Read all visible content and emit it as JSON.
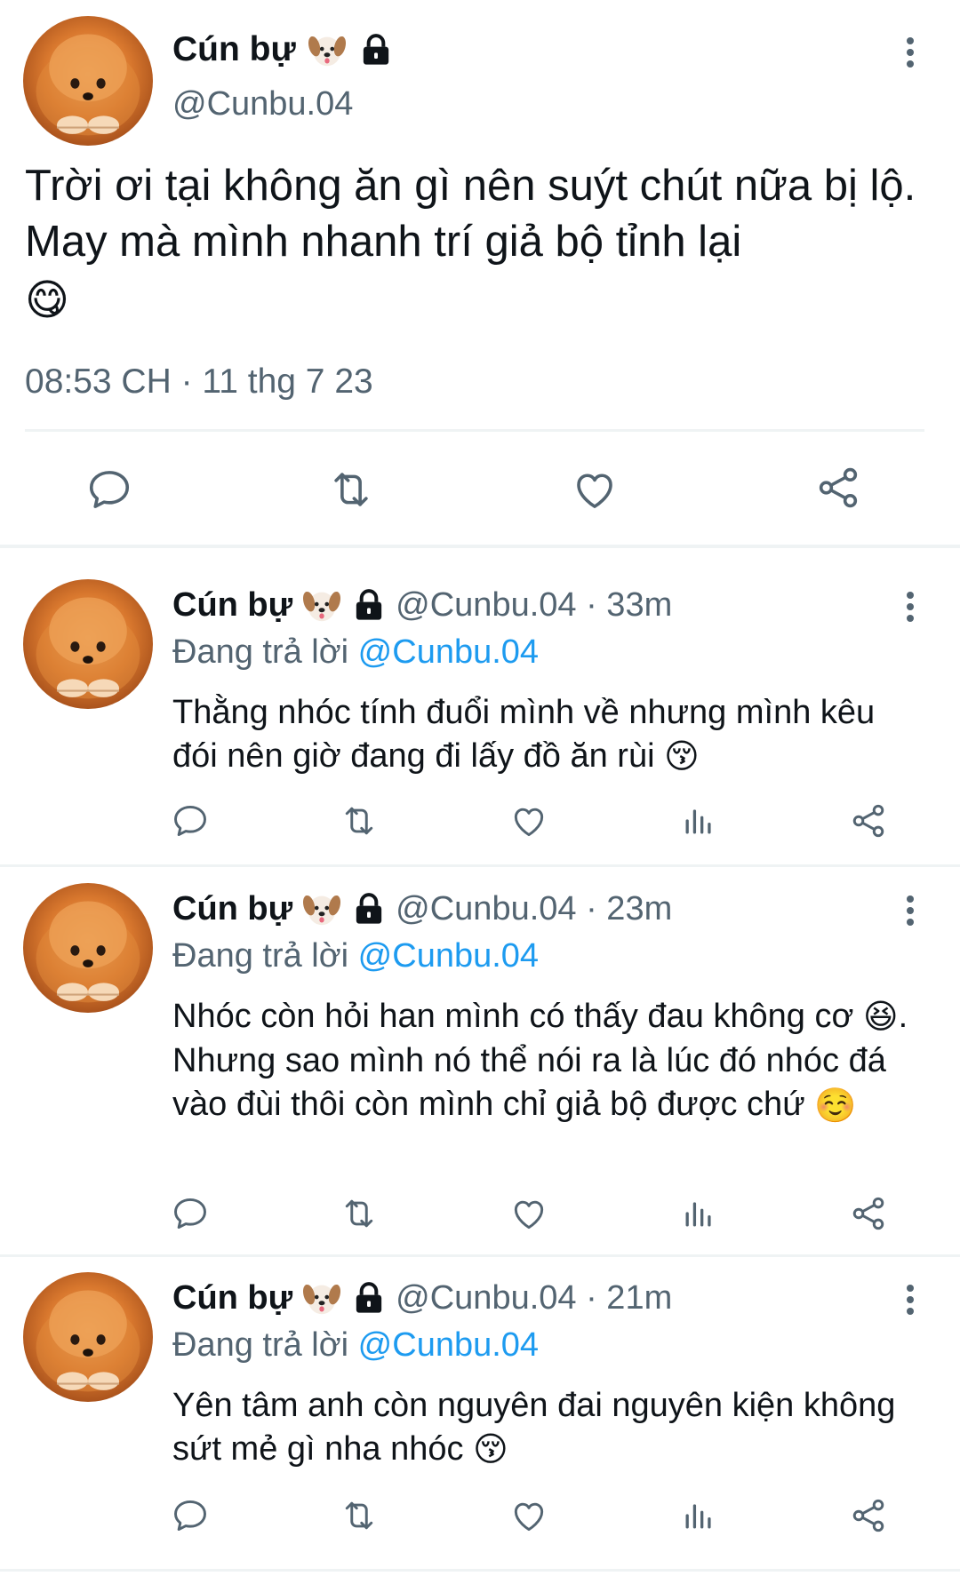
{
  "main_tweet": {
    "author_name": "Cún bự",
    "author_handle": "@Cunbu.04",
    "text": "Trời ơi tại không ăn gì nên suýt chút nữa bị lộ. May mà mình nhanh trí giả bộ tỉnh lại",
    "emoji": "😋",
    "timestamp": "08:53 CH · 11 thg 7 23",
    "actions": [
      "reply-icon",
      "retweet-icon",
      "like-icon",
      "share-icon"
    ]
  },
  "replies": [
    {
      "author_name": "Cún bự",
      "handle_time": "@Cunbu.04 · 33m",
      "replying_label": "Đang trả lời",
      "replying_to": "@Cunbu.04",
      "text": "Thằng nhóc tính đuổi mình về nhưng mình kêu đói nên giờ đang đi lấy đồ ăn rùi",
      "emoji": "😚"
    },
    {
      "author_name": "Cún bự",
      "handle_time": "@Cunbu.04 · 23m",
      "replying_label": "Đang trả lời",
      "replying_to": "@Cunbu.04",
      "text_part1": "Nhóc còn hỏi han mình có thấy đau không cơ",
      "emoji1": "😆",
      "text_part2": ". Nhưng sao mình nó thể nói ra là lúc đó nhóc đá vào đùi thôi còn mình chỉ giả bộ được chứ",
      "emoji2": "☺️"
    },
    {
      "author_name": "Cún bự",
      "handle_time": "@Cunbu.04 · 21m",
      "replying_label": "Đang trả lời",
      "replying_to": "@Cunbu.04",
      "text": "Yên tâm anh còn nguyên đai nguyên kiện không sứt mẻ gì nha nhóc",
      "emoji": "😚"
    }
  ],
  "reply_actions": [
    "reply-icon",
    "retweet-icon",
    "like-icon",
    "views-icon",
    "share-icon"
  ],
  "colors": {
    "text": "#0f1419",
    "secondary": "#536471",
    "link": "#1d9bf0",
    "divider": "#eff3f4"
  }
}
